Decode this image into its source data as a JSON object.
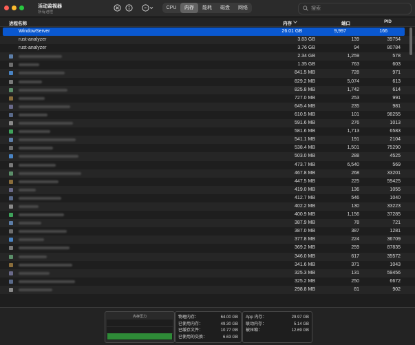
{
  "app": {
    "title": "活动监视器",
    "subtitle": "所有进程"
  },
  "tabs": [
    {
      "label": "CPU",
      "active": false
    },
    {
      "label": "内存",
      "active": true
    },
    {
      "label": "能耗",
      "active": false
    },
    {
      "label": "磁盘",
      "active": false
    },
    {
      "label": "网络",
      "active": false
    }
  ],
  "search": {
    "placeholder": "搜索",
    "value": ""
  },
  "columns": {
    "name": "进程名称",
    "memory": "内存",
    "ports": "端口",
    "pid": "PID"
  },
  "rows": [
    {
      "name": "WindowServer",
      "memory": "26.01 GB",
      "ports": "9,997",
      "pid": "166",
      "selected": true
    },
    {
      "name": "rust-analyzer",
      "memory": "3.83 GB",
      "ports": "139",
      "pid": "39754"
    },
    {
      "name": "rust-analyzer",
      "memory": "3.76 GB",
      "ports": "94",
      "pid": "80784"
    },
    {
      "name": "",
      "memory": "2.34 GB",
      "ports": "1,259",
      "pid": "578"
    },
    {
      "name": "",
      "memory": "1.35 GB",
      "ports": "763",
      "pid": "603"
    },
    {
      "name": "",
      "memory": "841.5 MB",
      "ports": "728",
      "pid": "971"
    },
    {
      "name": "",
      "memory": "829.2 MB",
      "ports": "5,074",
      "pid": "613"
    },
    {
      "name": "",
      "memory": "825.8 MB",
      "ports": "1,742",
      "pid": "614"
    },
    {
      "name": "",
      "memory": "727.0 MB",
      "ports": "253",
      "pid": "991"
    },
    {
      "name": "",
      "memory": "645.4 MB",
      "ports": "235",
      "pid": "981"
    },
    {
      "name": "",
      "memory": "610.5 MB",
      "ports": "101",
      "pid": "98255"
    },
    {
      "name": "",
      "memory": "591.6 MB",
      "ports": "276",
      "pid": "1013"
    },
    {
      "name": "",
      "memory": "581.6 MB",
      "ports": "1,713",
      "pid": "6583"
    },
    {
      "name": "",
      "memory": "541.1 MB",
      "ports": "191",
      "pid": "2104"
    },
    {
      "name": "",
      "memory": "538.4 MB",
      "ports": "1,501",
      "pid": "75290"
    },
    {
      "name": "",
      "memory": "503.0 MB",
      "ports": "288",
      "pid": "4525"
    },
    {
      "name": "",
      "memory": "473.7 MB",
      "ports": "6,540",
      "pid": "569"
    },
    {
      "name": "",
      "memory": "467.8 MB",
      "ports": "268",
      "pid": "33201"
    },
    {
      "name": "",
      "memory": "447.5 MB",
      "ports": "225",
      "pid": "59425"
    },
    {
      "name": "",
      "memory": "419.0 MB",
      "ports": "136",
      "pid": "1055"
    },
    {
      "name": "",
      "memory": "412.7 MB",
      "ports": "546",
      "pid": "1040"
    },
    {
      "name": "",
      "memory": "402.2 MB",
      "ports": "130",
      "pid": "33223"
    },
    {
      "name": "",
      "memory": "400.9 MB",
      "ports": "1,156",
      "pid": "37285"
    },
    {
      "name": "",
      "memory": "387.9 MB",
      "ports": "78",
      "pid": "721"
    },
    {
      "name": "",
      "memory": "387.0 MB",
      "ports": "387",
      "pid": "1281"
    },
    {
      "name": "",
      "memory": "377.8 MB",
      "ports": "224",
      "pid": "36709"
    },
    {
      "name": "",
      "memory": "369.2 MB",
      "ports": "259",
      "pid": "87835"
    },
    {
      "name": "",
      "memory": "346.0 MB",
      "ports": "617",
      "pid": "35572"
    },
    {
      "name": "",
      "memory": "341.6 MB",
      "ports": "371",
      "pid": "1043"
    },
    {
      "name": "",
      "memory": "325.3 MB",
      "ports": "131",
      "pid": "59456"
    },
    {
      "name": "",
      "memory": "325.2 MB",
      "ports": "250",
      "pid": "6672"
    },
    {
      "name": "",
      "memory": "298.8 MB",
      "ports": "81",
      "pid": "902"
    }
  ],
  "footer": {
    "pressure_title": "内存压力",
    "pressure_level": 0.3,
    "pressure_color": "#2e8b37",
    "stats_left": [
      {
        "label": "物理内存：",
        "value": "64.00 GB"
      },
      {
        "label": "已使用内存：",
        "value": "49.30 GB"
      },
      {
        "label": "已缓存文件：",
        "value": "10.77 GB"
      },
      {
        "label": "已使用的交换：",
        "value": "6.63 GB"
      }
    ],
    "stats_right": [
      {
        "label": "App 内存：",
        "value": "29.97 GB"
      },
      {
        "label": "联动内存：",
        "value": "5.14 GB"
      },
      {
        "label": "被压缩：",
        "value": "12.69 GB"
      }
    ]
  },
  "colors": {
    "selection": "#0a58d0",
    "background": "#1e1e1e"
  }
}
